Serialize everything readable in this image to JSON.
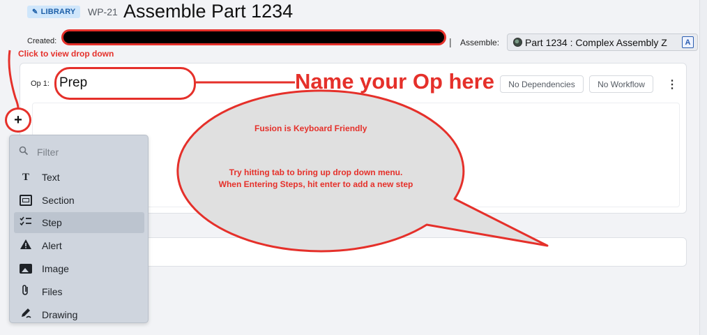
{
  "header": {
    "library_badge": "LIBRARY",
    "doc_id": "WP-21",
    "title": "Assemble Part 1234",
    "created_label": "Created:",
    "separator": "|",
    "assemble_label": "Assemble:",
    "assemble_value": "Part 1234 : Complex Assembly Z",
    "assemble_tag": "A"
  },
  "annotations": {
    "click_note": "Click to view drop down",
    "name_note": "Name your Op here",
    "bubble_title": "Fusion is Keyboard Friendly",
    "bubble_line1": "Try hitting tab to bring up drop down menu.",
    "bubble_line2": "When Entering Steps, hit enter to add a new step",
    "color": "#e5302a"
  },
  "op": {
    "label": "Op 1:",
    "name": "Prep",
    "dependencies": "No Dependencies",
    "workflow": "No Workflow",
    "menu_glyph": "⋮",
    "add_glyph": "+"
  },
  "dropdown": {
    "filter_placeholder": "Filter",
    "items": [
      {
        "label": "Text",
        "icon": "text-icon"
      },
      {
        "label": "Section",
        "icon": "section-icon"
      },
      {
        "label": "Step",
        "icon": "checklist-icon"
      },
      {
        "label": "Alert",
        "icon": "warning-icon"
      },
      {
        "label": "Image",
        "icon": "image-icon"
      },
      {
        "label": "Files",
        "icon": "paperclip-icon"
      },
      {
        "label": "Drawing",
        "icon": "draw-icon"
      }
    ],
    "active_item": "Step"
  }
}
